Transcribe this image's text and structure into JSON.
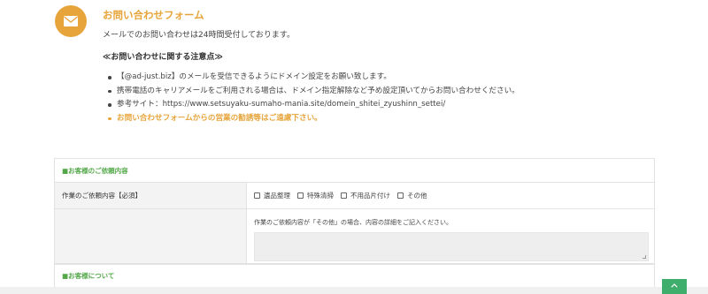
{
  "header": {
    "icon": "envelope-icon",
    "accent_color": "#e7a43a",
    "title": "お問い合わせフォーム",
    "intro": "メールでのお問い合わせは24時間受付しております。"
  },
  "notes": {
    "heading": "≪お問い合わせに関する注意点≫",
    "items": [
      "【@ad-just.biz】のメールを受信できるようにドメイン設定をお願い致します。",
      "携帯電話のキャリアメールをご利用される場合は、ドメイン指定解除など予め設定頂いてからお問い合わせください。",
      "参考サイト：https://www.setsuyaku-sumaho-mania.site/domein_shitei_zyushinn_settei/",
      "お問い合わせフォームからの営業の勧誘等はご遠慮下さい。"
    ]
  },
  "form": {
    "section_request": "■お客様のご依頼内容",
    "work_label": "作業のご依頼内容【必須】",
    "options": [
      "遺品整理",
      "特殊清掃",
      "不用品片付け",
      "その他"
    ],
    "details_hint": "作業のご依頼内容が「その他」の場合、内容の詳細をご記入ください。",
    "section_customer": "■お客様について",
    "section_color": "#54a84a"
  },
  "scroll_top": {
    "icon": "chevron-up-icon",
    "color": "#3fae6c"
  }
}
